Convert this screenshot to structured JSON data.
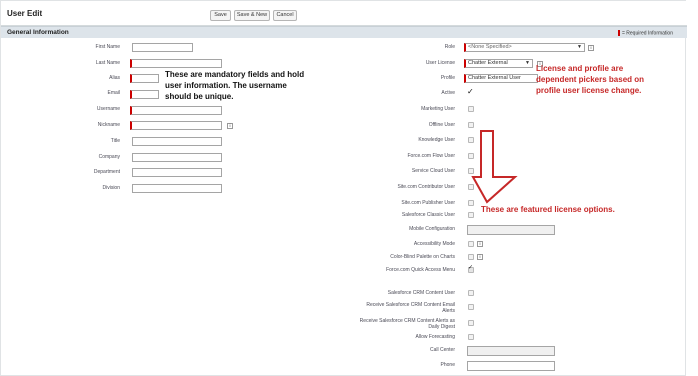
{
  "header": {
    "title": "User Edit",
    "save_label": "Save",
    "save_new_label": "Save & New",
    "cancel_label": "Cancel"
  },
  "section": {
    "title": "General Information",
    "required_info": "= Required Information"
  },
  "left_fields": {
    "first_name": "First Name",
    "last_name": "Last Name",
    "alias": "Alias",
    "email": "Email",
    "username": "Username",
    "nickname": "Nickname",
    "title": "Title",
    "company": "Company",
    "department": "Department",
    "division": "Division"
  },
  "right_fields": {
    "role": "Role",
    "role_value": "<None Specified>",
    "user_license": "User License",
    "user_license_value": "Chatter External",
    "profile": "Profile",
    "profile_value": "Chatter External User",
    "active": "Active",
    "marketing_user": "Marketing User",
    "offline_user": "Offline User",
    "knowledge_user": "Knowledge User",
    "flow_user": "Force.com Flow User",
    "service_cloud_user": "Service Cloud User",
    "site_contributor_user": "Site.com Contributor User",
    "site_publisher_user": "Site.com Publisher User",
    "salesforce_classic_user": "Salesforce Classic User",
    "mobile_configuration": "Mobile Configuration",
    "accessibility_mode": "Accessibility Mode",
    "color_blind_palette": "Color-Blind Palette on Charts",
    "quick_access_menu": "Force.com Quick Access Menu",
    "crm_content_user": "Salesforce CRM Content User",
    "crm_content_email_alerts_1": "Receive Salesforce CRM Content Email",
    "crm_content_email_alerts_2": "Alerts",
    "crm_content_alerts_digest_1": "Receive Salesforce CRM Content Alerts as",
    "crm_content_alerts_digest_2": "Daily Digest",
    "allow_forecasting": "Allow Forecasting",
    "call_center": "Call Center",
    "phone": "Phone"
  },
  "annotations": {
    "mandatory_1": "These are mandatory fields and hold",
    "mandatory_2": "user information. The username",
    "mandatory_3": "should be unique.",
    "license_1": "License and profile are",
    "license_2": "dependent pickers based on",
    "license_3": "profile user license change.",
    "featured": "These are featured license options."
  },
  "colors": {
    "required": "#cc0000",
    "annotation_red": "#c62828",
    "section_bg": "#dde4ea"
  }
}
